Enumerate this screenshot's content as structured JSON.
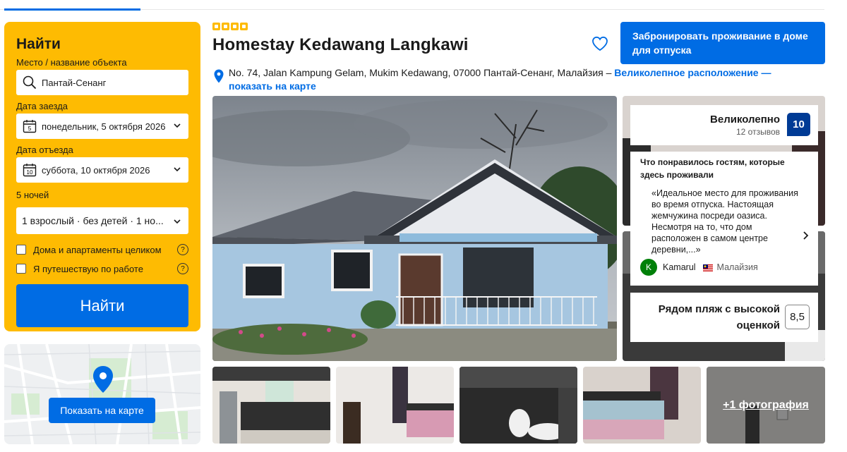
{
  "search": {
    "title": "Найти",
    "destination_label": "Место / название объекта",
    "destination_value": "Пантай-Сенанг",
    "checkin_label": "Дата заезда",
    "checkin_value": "понедельник, 5 октября 2026",
    "checkin_day": "5",
    "checkout_label": "Дата отъезда",
    "checkout_value": "суббота, 10 октября 2026",
    "checkout_day": "10",
    "nights": "5 ночей",
    "guests_value": "1 взрослый · без детей · 1 но...",
    "option_whole": "Дома и апартаменты целиком",
    "option_work": "Я путешествую по работе",
    "help_symbol": "?",
    "search_button": "Найти"
  },
  "map": {
    "button": "Показать на карте"
  },
  "hotel": {
    "name": "Homestay Kedawang Langkawi",
    "star_count": 4,
    "address": "No. 74, Jalan Kampung Gelam, Mukim Kedawang, 07000 Пантай-Сенанг, Малайзия –",
    "location_tag": "Великолепное расположение —",
    "show_on_map": "показать на карте",
    "book_button": "Забронировать проживание в доме для отпуска"
  },
  "reviews": {
    "score_word": "Великолепно",
    "review_count": "12 отзывов",
    "score": "10",
    "liked_title": "Что понравилось гостям, которые здесь проживали",
    "quote": "«Идеальное место для проживания во время отпуска. Настоящая жемчужина посреди оазиса. Несмотря на то, что дом расположен в самом центре деревни,...»",
    "reviewer_initial": "K",
    "reviewer_name": "Kamarul",
    "reviewer_country": "Малайзия",
    "beach_label": "Рядом пляж с высокой оценкой",
    "beach_score": "8,5"
  },
  "gallery": {
    "more_photos": "+1 фотография"
  },
  "colors": {
    "brand_blue": "#006ce4",
    "dark_blue": "#003b95",
    "yellow": "#febb02",
    "green": "#008009"
  }
}
